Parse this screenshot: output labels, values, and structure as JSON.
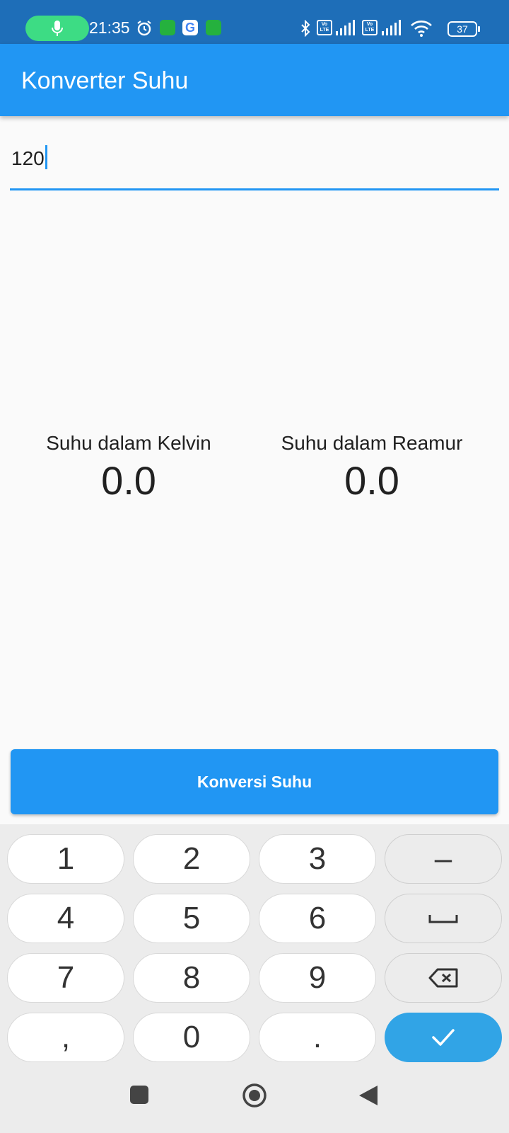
{
  "status_bar": {
    "time": "21:35",
    "battery": "37",
    "icons": [
      "mic-icon",
      "alarm-icon",
      "whatsapp-icon",
      "google-icon",
      "whatsapp-icon",
      "bluetooth-icon",
      "volte-icon",
      "signal-icon",
      "volte-icon",
      "signal-icon",
      "wifi-icon",
      "battery-icon"
    ],
    "volte_label": "Vo LTE"
  },
  "app_bar": {
    "title": "Konverter Suhu"
  },
  "input": {
    "value": "120"
  },
  "results": {
    "kelvin": {
      "label": "Suhu dalam Kelvin",
      "value": "0.0"
    },
    "reamur": {
      "label": "Suhu dalam Reamur",
      "value": "0.0"
    }
  },
  "convert_button": {
    "label": "Konversi Suhu"
  },
  "keypad": {
    "keys": [
      "1",
      "2",
      "3",
      "–",
      "4",
      "5",
      "6",
      "space",
      "7",
      "8",
      "9",
      "backspace",
      ",",
      "0",
      ".",
      "done"
    ],
    "digits": {
      "k1": "1",
      "k2": "2",
      "k3": "3",
      "k4": "4",
      "k5": "5",
      "k6": "6",
      "k7": "7",
      "k8": "8",
      "k9": "9",
      "k0": "0",
      "comma": ",",
      "dot": ".",
      "minus": "–"
    }
  },
  "nav_bar": {
    "icons": [
      "square-icon",
      "home-circle-icon",
      "back-triangle-icon"
    ]
  },
  "colors": {
    "primary": "#2196f3",
    "status_bar": "#1e6eb8",
    "done_key": "#31a4e6",
    "mic_pill": "#3ddc84"
  }
}
